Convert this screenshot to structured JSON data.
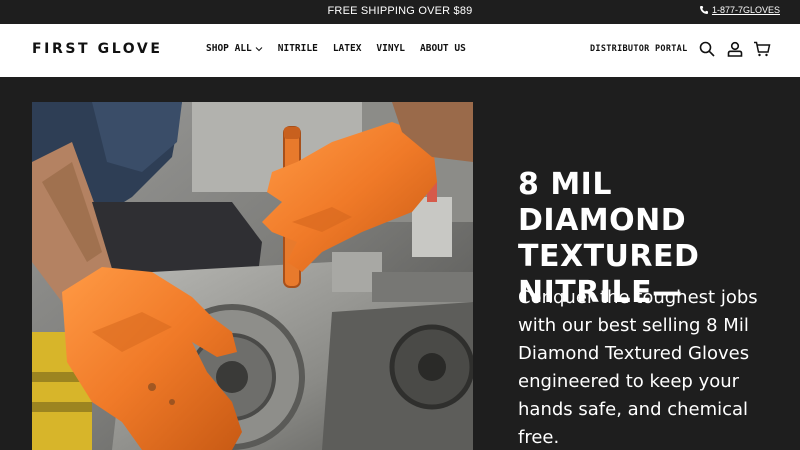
{
  "announcement": {
    "text": "FREE SHIPPING OVER $89",
    "phone": "1-877-7GLOVES"
  },
  "header": {
    "logo": "FIRST GLOVE",
    "nav": [
      {
        "label": "SHOP ALL",
        "has_dropdown": true
      },
      {
        "label": "NITRILE"
      },
      {
        "label": "LATEX"
      },
      {
        "label": "VINYL"
      },
      {
        "label": "ABOUT US"
      }
    ],
    "distributor_portal": "DISTRIBUTOR PORTAL",
    "icons": [
      "search-icon",
      "account-icon",
      "cart-icon"
    ]
  },
  "hero": {
    "title": "8 MIL DIAMOND TEXTURED NITRILE—",
    "description": "Conquer the toughest jobs with our best selling 8 Mil Diamond Textured Gloves engineered to keep your hands safe, and chemical free.",
    "image": "mechanic-orange-gloves-engine-photo"
  },
  "colors": {
    "background_dark": "#1e1e1e",
    "header_bg": "#ffffff",
    "glove_orange": "#f07a28",
    "text_light": "#ffffff"
  }
}
